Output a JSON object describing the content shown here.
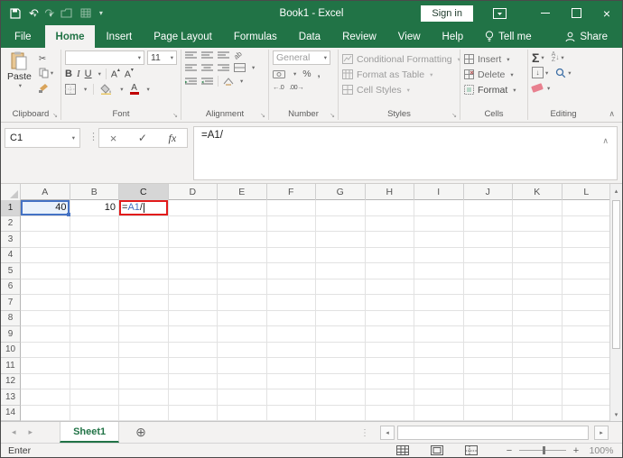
{
  "title_bar": {
    "title": "Book1 - Excel",
    "sign_in_label": "Sign in"
  },
  "menu": {
    "file": "File",
    "home": "Home",
    "insert": "Insert",
    "page_layout": "Page Layout",
    "formulas": "Formulas",
    "data": "Data",
    "review": "Review",
    "view": "View",
    "help": "Help",
    "tell_me": "Tell me",
    "share": "Share"
  },
  "ribbon": {
    "groups": {
      "clipboard": {
        "label": "Clipboard",
        "paste_label": "Paste"
      },
      "font": {
        "label": "Font",
        "font_size": "11",
        "bold": "B",
        "italic": "I",
        "underline": "U",
        "font_color_letter": "A",
        "grow_letter": "A",
        "shrink_letter": "A"
      },
      "alignment": {
        "label": "Alignment",
        "orientation_text": "ab"
      },
      "number": {
        "label": "Number",
        "format": "General",
        "percent": "%",
        "comma": ",",
        "inc_decimal": "←.0",
        "dec_decimal": ".00→"
      },
      "styles": {
        "label": "Styles",
        "items": [
          "Conditional Formatting",
          "Format as Table",
          "Cell Styles"
        ]
      },
      "cells": {
        "label": "Cells",
        "items": [
          "Insert",
          "Delete",
          "Format"
        ]
      },
      "editing": {
        "label": "Editing",
        "autosum": "Σ",
        "sort_a": "A",
        "sort_z": "Z"
      }
    }
  },
  "formula_bar": {
    "name_box": "C1",
    "content": "=A1/"
  },
  "grid": {
    "columns": [
      "A",
      "B",
      "C",
      "D",
      "E",
      "F",
      "G",
      "H",
      "I",
      "J",
      "K",
      "L"
    ],
    "row_count": 14,
    "selected_column": "C",
    "selected_row": 1,
    "cells": [
      {
        "ref": "A1",
        "value": "40",
        "align": "right",
        "style": "referenced"
      },
      {
        "ref": "B1",
        "value": "10",
        "align": "right"
      },
      {
        "ref": "C1",
        "style": "editing-red",
        "parts": [
          {
            "text": "=",
            "color": "#1f1f1f"
          },
          {
            "text": "A1",
            "color": "#4472c4"
          },
          {
            "text": "/",
            "color": "#1f1f1f"
          }
        ]
      }
    ]
  },
  "sheet_bar": {
    "active_tab": "Sheet1"
  },
  "status_bar": {
    "mode": "Enter",
    "zoom_level": "100%"
  },
  "colors": {
    "accent_green": "#217346",
    "reference_blue": "#4472c4",
    "annotation_red": "#e21b1b"
  },
  "icons": {
    "undo": "↶",
    "redo": "↷",
    "dropdown": "▾",
    "cut": "✂",
    "check": "✓",
    "cancel": "×",
    "function": "fx",
    "dots": "⋮",
    "launcher": "↘",
    "add_sheet": "⊕",
    "chevron_up": "∧",
    "scroll_left": "◂",
    "scroll_right": "▸",
    "scroll_up": "▴",
    "scroll_down": "▾",
    "zoom_out": "−",
    "zoom_in": "+",
    "close": "×"
  }
}
